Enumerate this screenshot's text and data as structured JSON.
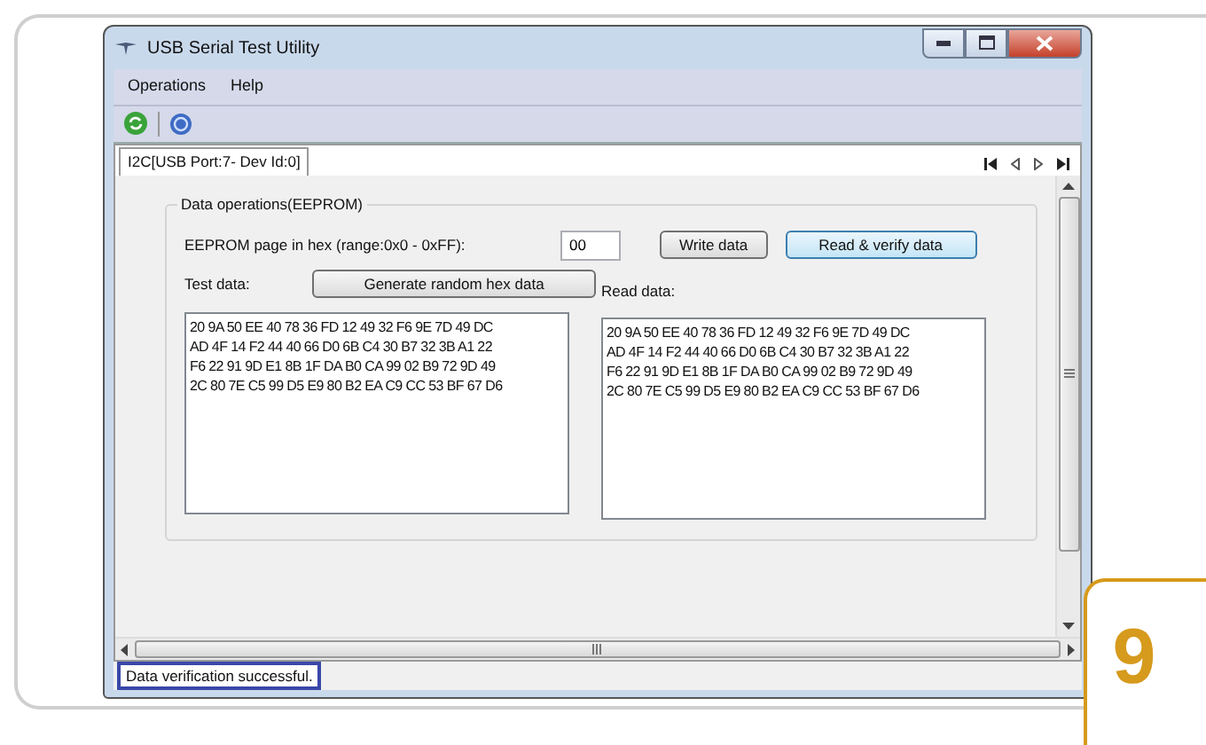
{
  "window": {
    "title": "USB Serial Test Utility"
  },
  "menu": [
    "Operations",
    "Help"
  ],
  "tabs": [
    {
      "label": "I2C[USB Port:7- Dev Id:0]",
      "selected": true
    }
  ],
  "group": {
    "title": "Data operations(EEPROM)",
    "page_label": "EEPROM page in hex (range:0x0 - 0xFF):",
    "page_value": "00",
    "buttons": [
      {
        "label": "Write data",
        "selected": false
      },
      {
        "label": "Read & verify data",
        "selected": true
      }
    ],
    "test_label": "Test data:",
    "generate_button": "Generate random hex data",
    "read_label": "Read data:",
    "test_lines": [
      "20 9A 50 EE 40 78 36 FD 12 49 32 F6 9E 7D 49 DC",
      "AD 4F 14 F2 44 40 66 D0 6B C4 30 B7 32 3B A1 22",
      "F6 22 91 9D E1 8B 1F DA B0 CA 99 02 B9 72 9D 49",
      "2C 80 7E C5 99 D5 E9 80 B2 EA C9 CC 53 BF 67 D6"
    ],
    "read_lines": [
      "20 9A 50 EE 40 78 36 FD 12 49 32 F6 9E 7D 49 DC",
      "AD 4F 14 F2 44 40 66 D0 6B C4 30 B7 32 3B A1 22",
      "F6 22 91 9D E1 8B 1F DA B0 CA 99 02 B9 72 9D 49",
      "2C 80 7E C5 99 D5 E9 80 B2 EA C9 CC 53 BF 67 D6"
    ]
  },
  "status_bar": "Data verification successful.",
  "step_number": "9"
}
